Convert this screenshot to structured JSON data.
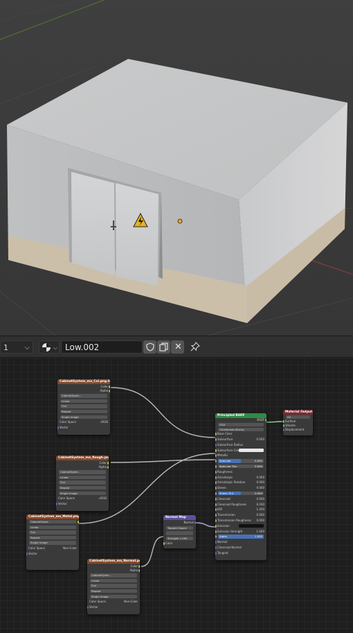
{
  "header": {
    "frame_value": "1",
    "material_name": "Low.002"
  },
  "nodes": {
    "tex1": {
      "title": "CabinetSystem_ma_Col.png.001",
      "out_color": "Color",
      "out_alpha": "Alpha",
      "image_name": "CabinetSyste...",
      "interp": "Linear",
      "projection": "Flat",
      "extension": "Repeat",
      "source": "Single Image",
      "colorspace_label": "Color Space",
      "colorspace_value": "sRGB",
      "vector": "Vector"
    },
    "tex2": {
      "title": "CabinetSystem_ma_Rough.png.001",
      "out_color": "Color",
      "out_alpha": "Alpha",
      "image_name": "CabinetSyste...",
      "interp": "Linear",
      "projection": "Flat",
      "extension": "Repeat",
      "source": "Single Image",
      "colorspace_label": "Color Space",
      "colorspace_value": "sRGB",
      "vector": "Vector"
    },
    "tex3": {
      "title": "CabinetSystem_ma_Metal.png.001",
      "out_color": "Color",
      "out_alpha": "Alpha",
      "image_name": "CabinetSyste...",
      "interp": "Linear",
      "projection": "Flat",
      "extension": "Repeat",
      "source": "Single Image",
      "colorspace_label": "Color Space",
      "colorspace_value": "Non-Color",
      "vector": "Vector"
    },
    "tex4": {
      "title": "CabinetSystem_ma_Normal.png.001",
      "out_color": "Color",
      "out_alpha": "Alpha",
      "image_name": "CabinetSyste...",
      "interp": "Linear",
      "projection": "Flat",
      "extension": "Repeat",
      "source": "Single Image",
      "colorspace_label": "Color Space",
      "colorspace_value": "Non-Color",
      "vector": "Vector"
    },
    "normalmap": {
      "title": "Normal Map",
      "out_normal": "Normal",
      "space": "Tangent Space",
      "uvmap": "",
      "strength_label": "Strength",
      "strength_value": "1.000",
      "in_color": "Color"
    },
    "bsdf": {
      "title": "Principled BSDF",
      "out_bsdf": "BSDF",
      "distribution": "GGX",
      "subsurface_method": "Christensen-Burley",
      "rows": [
        {
          "label": "Base Color",
          "value": ""
        },
        {
          "label": "Subsurface",
          "value": "0.000"
        },
        {
          "label": "Subsurface Radius",
          "value": ""
        },
        {
          "label": "Subsurface Color",
          "value": ""
        },
        {
          "label": "Metallic",
          "value": ""
        },
        {
          "label": "Specular",
          "value": "0.500"
        },
        {
          "label": "Specular Tint",
          "value": "0.000"
        },
        {
          "label": "Roughness",
          "value": ""
        },
        {
          "label": "Anisotropic",
          "value": "0.000"
        },
        {
          "label": "Anisotropic Rotation",
          "value": "0.000"
        },
        {
          "label": "Sheen",
          "value": "0.000"
        },
        {
          "label": "Sheen Tint",
          "value": "0.500"
        },
        {
          "label": "Clearcoat",
          "value": "0.000"
        },
        {
          "label": "Clearcoat Roughness",
          "value": "0.030"
        },
        {
          "label": "IOR",
          "value": "1.450"
        },
        {
          "label": "Transmission",
          "value": "0.000"
        },
        {
          "label": "Transmission Roughness",
          "value": "0.000"
        },
        {
          "label": "Emission",
          "value": ""
        },
        {
          "label": "Emission Strength",
          "value": "1.000"
        },
        {
          "label": "Alpha",
          "value": "1.000"
        },
        {
          "label": "Normal",
          "value": ""
        },
        {
          "label": "Clearcoat Normal",
          "value": ""
        },
        {
          "label": "Tangent",
          "value": ""
        }
      ]
    },
    "output": {
      "title": "Material Output",
      "target": "All",
      "in_surface": "Surface",
      "in_volume": "Volume",
      "in_displacement": "Displacement"
    }
  },
  "colors": {
    "texture_header": "#83492b",
    "bsdf_header": "#2f8a45",
    "vector_header": "#5d4f9e",
    "output_header": "#7a2c34",
    "socket_color": "#c7c729",
    "socket_gray": "#a1a1a1",
    "socket_green": "#63c763",
    "socket_purple": "#6363c7",
    "socket_blue": "#6363c7",
    "slider_fill": "#4772b3"
  },
  "icons": [
    "editor-type-icon",
    "material-browse-icon",
    "fake-user-shield-icon",
    "duplicate-icon",
    "close-icon",
    "pin-icon",
    "warning-sign-icon",
    "light-origin-icon"
  ]
}
